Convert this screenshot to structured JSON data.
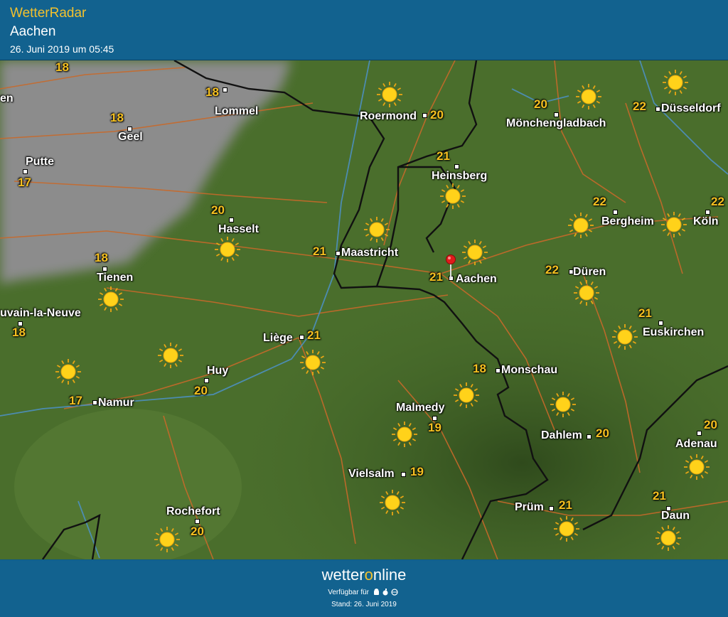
{
  "header": {
    "app_title": "WetterRadar",
    "location": "Aachen",
    "datetime": "26. Juni 2019 um 05:45"
  },
  "map": {
    "cities": [
      {
        "name": "Lommel",
        "temp": "18"
      },
      {
        "name": "Geel",
        "temp": "18"
      },
      {
        "name": "Putte",
        "temp": "17"
      },
      {
        "name": "Hasselt",
        "temp": "20"
      },
      {
        "name": "Tienen",
        "temp": "18"
      },
      {
        "name": "uvain-la-Neuve",
        "temp": "18"
      },
      {
        "name": "Namur",
        "temp": "17"
      },
      {
        "name": "Huy",
        "temp": "20"
      },
      {
        "name": "Liège",
        "temp": "21"
      },
      {
        "name": "Maastricht",
        "temp": "21"
      },
      {
        "name": "Roermond",
        "temp": "20"
      },
      {
        "name": "Heinsberg",
        "temp": "21"
      },
      {
        "name": "Mönchengladbach",
        "temp": "20"
      },
      {
        "name": "Düsseldorf",
        "temp": "22"
      },
      {
        "name": "Bergheim",
        "temp": "22"
      },
      {
        "name": "Köln",
        "temp": "22"
      },
      {
        "name": "Aachen",
        "temp": "21"
      },
      {
        "name": "Düren",
        "temp": "22"
      },
      {
        "name": "Euskirchen",
        "temp": "21"
      },
      {
        "name": "Monschau",
        "temp": "18"
      },
      {
        "name": "Malmedy",
        "temp": "19"
      },
      {
        "name": "Vielsalm",
        "temp": "19"
      },
      {
        "name": "Dahlem",
        "temp": "20"
      },
      {
        "name": "Adenau",
        "temp": "20"
      },
      {
        "name": "Prüm",
        "temp": "21"
      },
      {
        "name": "Daun",
        "temp": "21"
      },
      {
        "name": "Rochefort",
        "temp": "20"
      },
      {
        "name": "en",
        "temp": ""
      }
    ],
    "extra_temps": [
      "18"
    ],
    "icon": "sun-icon",
    "colors": {
      "land": "#4a6e2c",
      "cloud": "#8a8a8a",
      "temp": "#f5c020",
      "border": "#111111",
      "road": "#c8692a",
      "river": "#4d8fbf",
      "marker": "#e11b1b"
    }
  },
  "footer": {
    "brand_prefix": "wetter",
    "brand_o": "o",
    "brand_suffix": "nline",
    "available": "Verfügbar für",
    "stand": "Stand: 26. Juni 2019"
  }
}
